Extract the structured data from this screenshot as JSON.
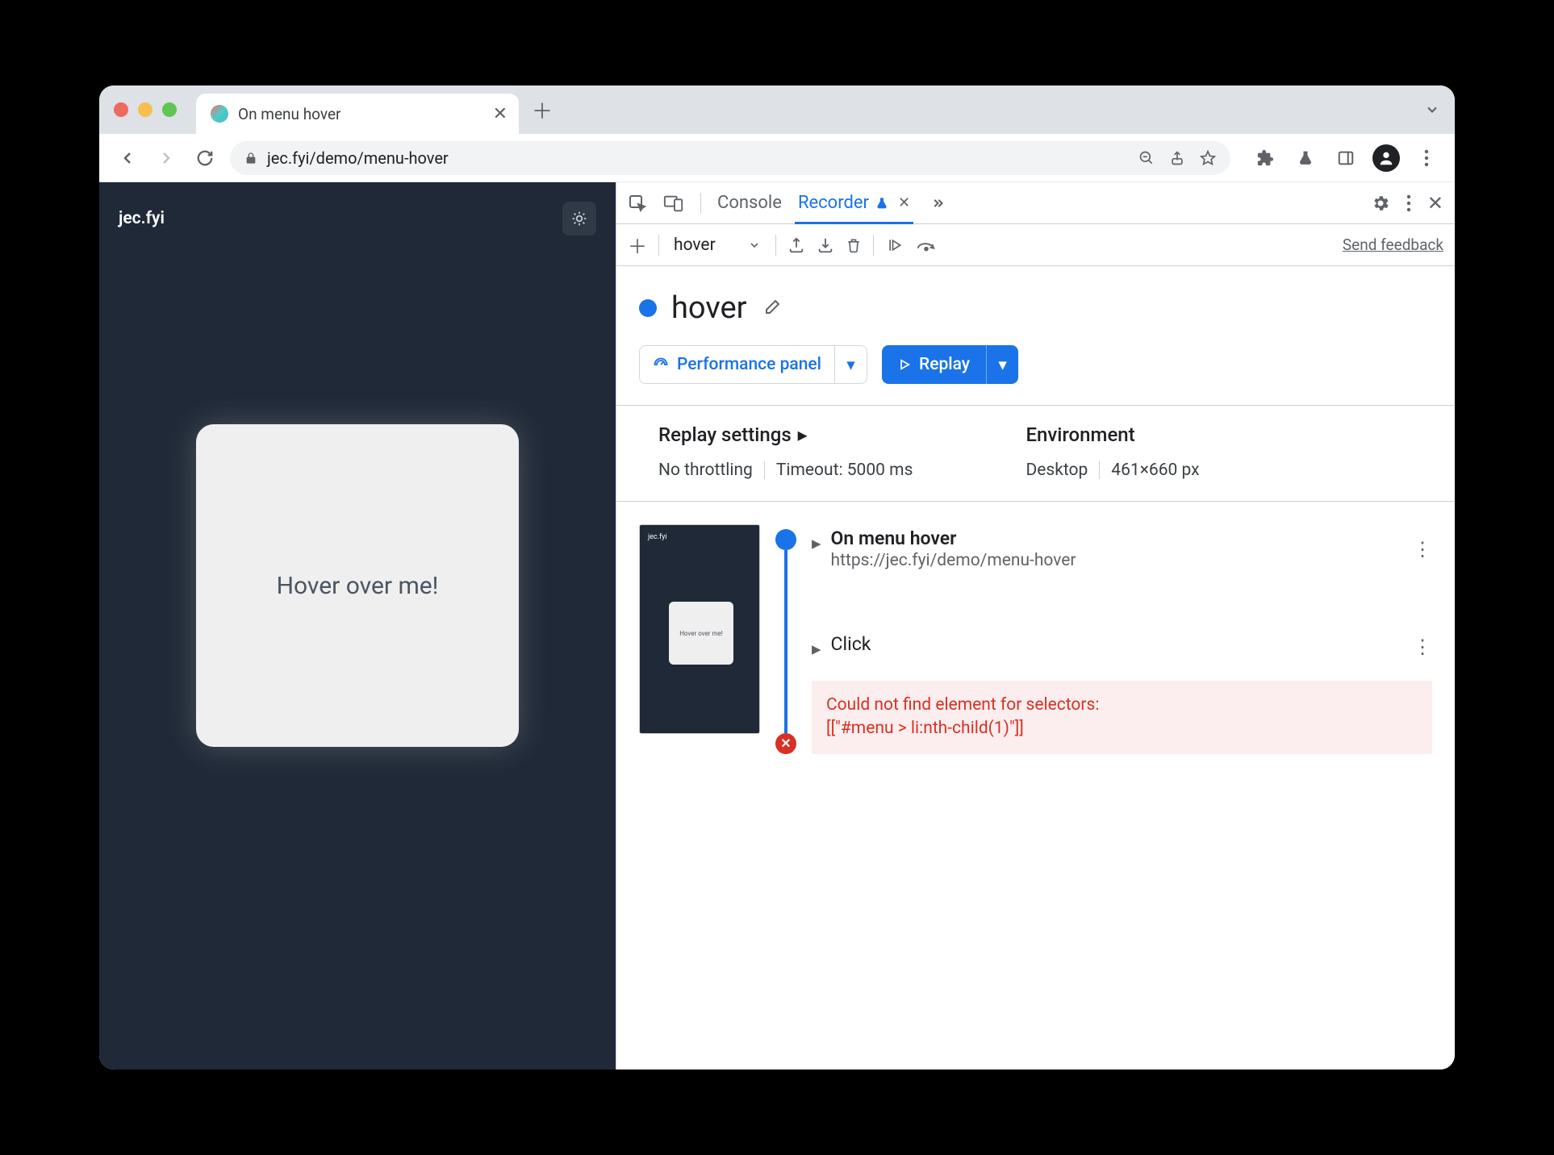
{
  "browser_tab": {
    "title": "On menu hover"
  },
  "omnibox": {
    "url": "jec.fyi/demo/menu-hover"
  },
  "page": {
    "site_name": "jec.fyi",
    "card_text": "Hover over me!"
  },
  "devtools": {
    "tabs": {
      "console": "Console",
      "recorder": "Recorder"
    }
  },
  "recorder": {
    "current_recording_name": "hover",
    "send_feedback": "Send feedback",
    "title": "hover",
    "perf_button": "Performance panel",
    "replay_button": "Replay",
    "replay_settings": {
      "label": "Replay settings",
      "throttling": "No throttling",
      "timeout": "Timeout: 5000 ms"
    },
    "environment": {
      "label": "Environment",
      "device": "Desktop",
      "viewport": "461×660 px"
    },
    "steps": {
      "start": {
        "title": "On menu hover",
        "url": "https://jec.fyi/demo/menu-hover"
      },
      "click": {
        "title": "Click"
      }
    },
    "error_line1": "Could not find element for selectors:",
    "error_line2": "[[\"#menu > li:nth-child(1)\"]]",
    "thumb_card_text": "Hover over me!"
  }
}
